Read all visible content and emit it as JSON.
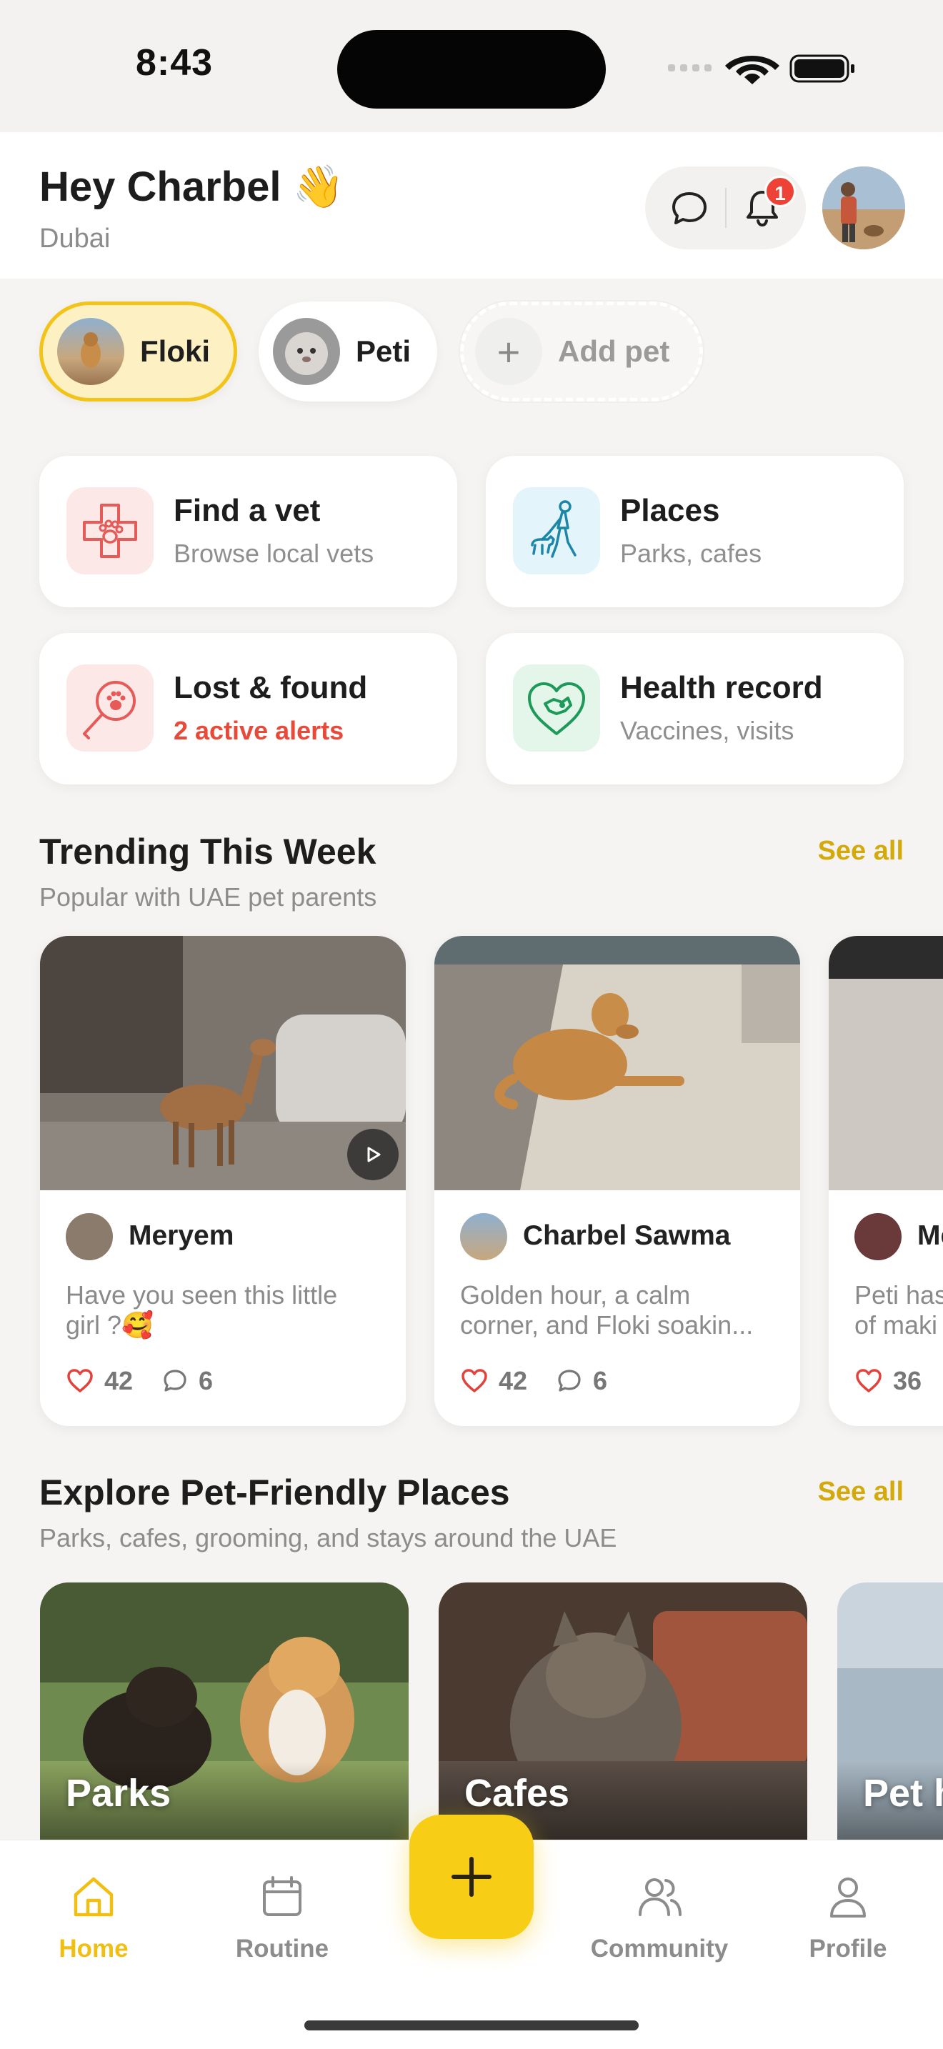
{
  "status_bar": {
    "time": "8:43"
  },
  "header": {
    "greeting": "Hey Charbel 👋",
    "location": "Dubai",
    "notification_count": "1"
  },
  "pets": [
    {
      "name": "Floki",
      "selected": true
    },
    {
      "name": "Peti",
      "selected": false
    }
  ],
  "add_pet_label": "Add pet",
  "actions": [
    {
      "title": "Find a vet",
      "subtitle": "Browse local vets",
      "icon": "vet-paw-cross-icon"
    },
    {
      "title": "Places",
      "subtitle": "Parks, cafes",
      "icon": "dog-walker-icon"
    },
    {
      "title": "Lost & found",
      "subtitle": "2 active alerts",
      "icon": "magnifier-paw-icon"
    },
    {
      "title": "Health record",
      "subtitle": "Vaccines, visits",
      "icon": "heart-dog-icon"
    }
  ],
  "trending": {
    "title": "Trending This Week",
    "subtitle": "Popular with UAE pet parents",
    "see_all": "See all",
    "posts": [
      {
        "author": "Meryem",
        "caption_1": "Have you seen this little",
        "caption_2": "girl ?🥰",
        "likes": "42",
        "comments": "6",
        "is_video": true
      },
      {
        "author": "Charbel Sawma",
        "caption_1": "Golden hour, a calm",
        "caption_2": "corner, and Floki soakin...",
        "likes": "42",
        "comments": "6",
        "is_video": false
      },
      {
        "author": "Me",
        "caption_1": "Peti has",
        "caption_2": "of maki",
        "likes": "36",
        "comments": "",
        "is_video": false
      }
    ]
  },
  "places": {
    "title": "Explore Pet-Friendly Places",
    "subtitle": "Parks, cafes, grooming, and stays around the UAE",
    "see_all": "See all",
    "items": [
      {
        "label": "Parks"
      },
      {
        "label": "Cafes"
      },
      {
        "label": "Pet h"
      }
    ]
  },
  "nav": {
    "home": "Home",
    "routine": "Routine",
    "community": "Community",
    "profile": "Profile"
  },
  "colors": {
    "accent": "#f7cd16",
    "alert": "#e84a3a",
    "see_all": "#d4a90c"
  }
}
